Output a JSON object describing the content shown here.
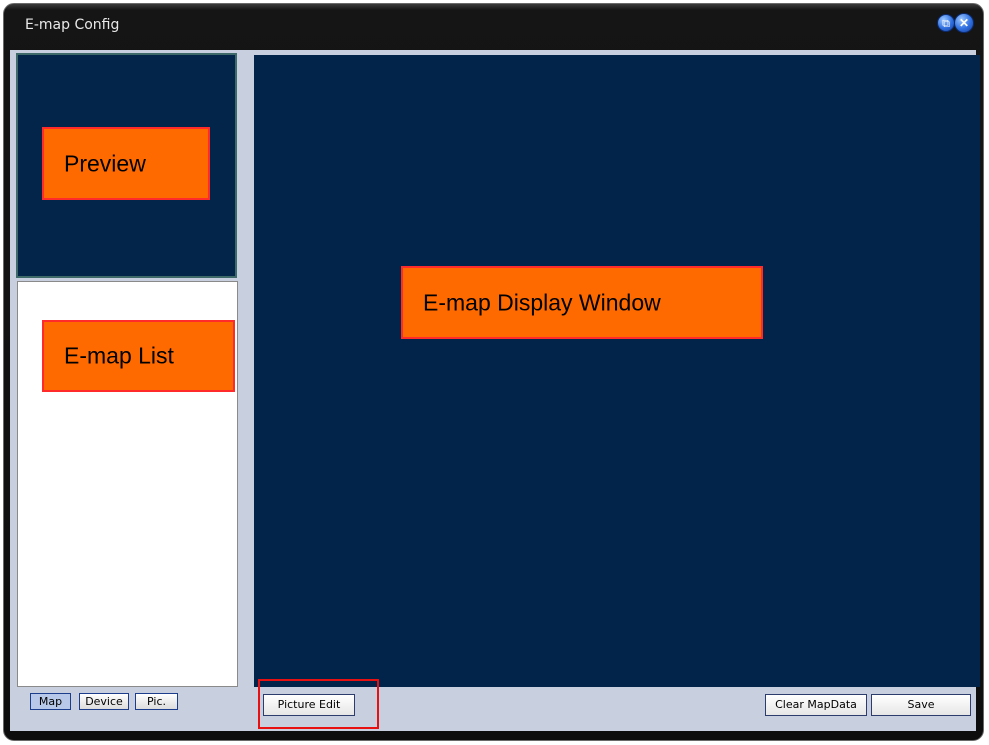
{
  "window": {
    "title": "E-map Config"
  },
  "panels": {
    "preview_label": "Preview",
    "list_label": "E-map List",
    "display_label": "E-map Display Window"
  },
  "tabs": [
    {
      "label": "Map",
      "active": true
    },
    {
      "label": "Device",
      "active": false
    },
    {
      "label": "Pic.",
      "active": false
    }
  ],
  "buttons": {
    "picture_edit": "Picture Edit",
    "clear_map_data": "Clear MapData",
    "save": "Save"
  },
  "icons": {
    "restore": "restore-icon",
    "close": "close-icon"
  },
  "colors": {
    "display_bg": "#02244a",
    "annotation_fill": "#ff6a00",
    "annotation_border": "#ff2a2a"
  }
}
